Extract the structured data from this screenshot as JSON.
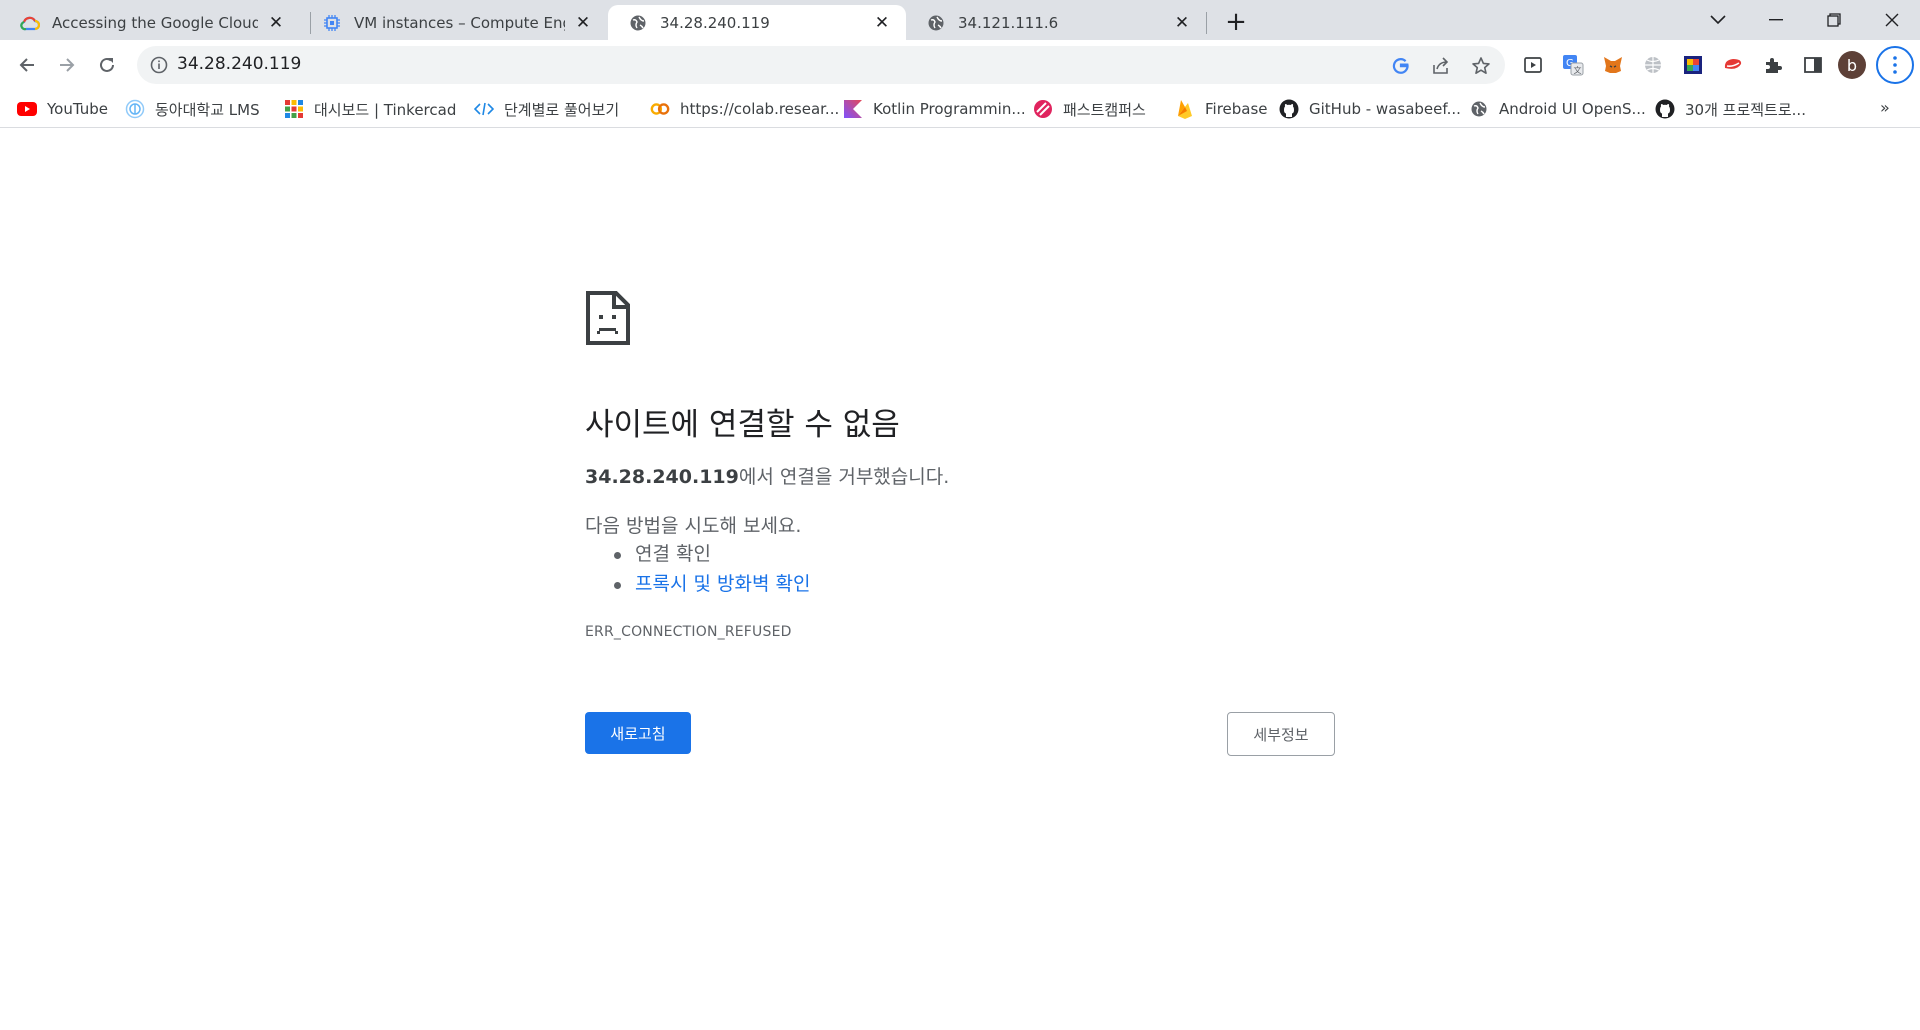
{
  "tabs": [
    {
      "title": "Accessing the Google Cloud Co",
      "favicon": "google-cloud-icon",
      "active": false
    },
    {
      "title": "VM instances – Compute Engine",
      "favicon": "compute-engine-icon",
      "active": false
    },
    {
      "title": "34.28.240.119",
      "favicon": "globe-icon",
      "active": true
    },
    {
      "title": "34.121.111.6",
      "favicon": "globe-icon",
      "active": false
    }
  ],
  "toolbar": {
    "url": "34.28.240.119",
    "avatar_letter": "b"
  },
  "bookmarks": [
    {
      "label": "YouTube",
      "icon": "youtube-icon"
    },
    {
      "label": "동아대학교 LMS",
      "icon": "lms-icon"
    },
    {
      "label": "대시보드 | Tinkercad",
      "icon": "tinkercad-icon"
    },
    {
      "label": "단계별로 풀어보기",
      "icon": "code-icon"
    },
    {
      "label": "https://colab.resear...",
      "icon": "colab-icon"
    },
    {
      "label": "Kotlin Programmin...",
      "icon": "kotlin-icon"
    },
    {
      "label": "패스트캠퍼스",
      "icon": "fastcampus-icon"
    },
    {
      "label": "Firebase",
      "icon": "firebase-icon"
    },
    {
      "label": "GitHub - wasabeef...",
      "icon": "github-icon"
    },
    {
      "label": "Android UI OpenS...",
      "icon": "globe-icon"
    },
    {
      "label": "30개 프로젝트로...",
      "icon": "github-icon"
    }
  ],
  "bookmarks_more": "»",
  "error": {
    "title": "사이트에 연결할 수 없음",
    "host": "34.28.240.119",
    "desc_suffix": "에서 연결을 거부했습니다.",
    "suggest_heading": "다음 방법을 시도해 보세요.",
    "suggestions": [
      "연결 확인",
      "프록시 및 방화벽 확인"
    ],
    "code": "ERR_CONNECTION_REFUSED",
    "reload_label": "새로고침",
    "details_label": "세부정보"
  },
  "colors": {
    "accent": "#1a73e8",
    "tabstrip": "#dee1e6",
    "omnibox": "#f1f3f4"
  }
}
